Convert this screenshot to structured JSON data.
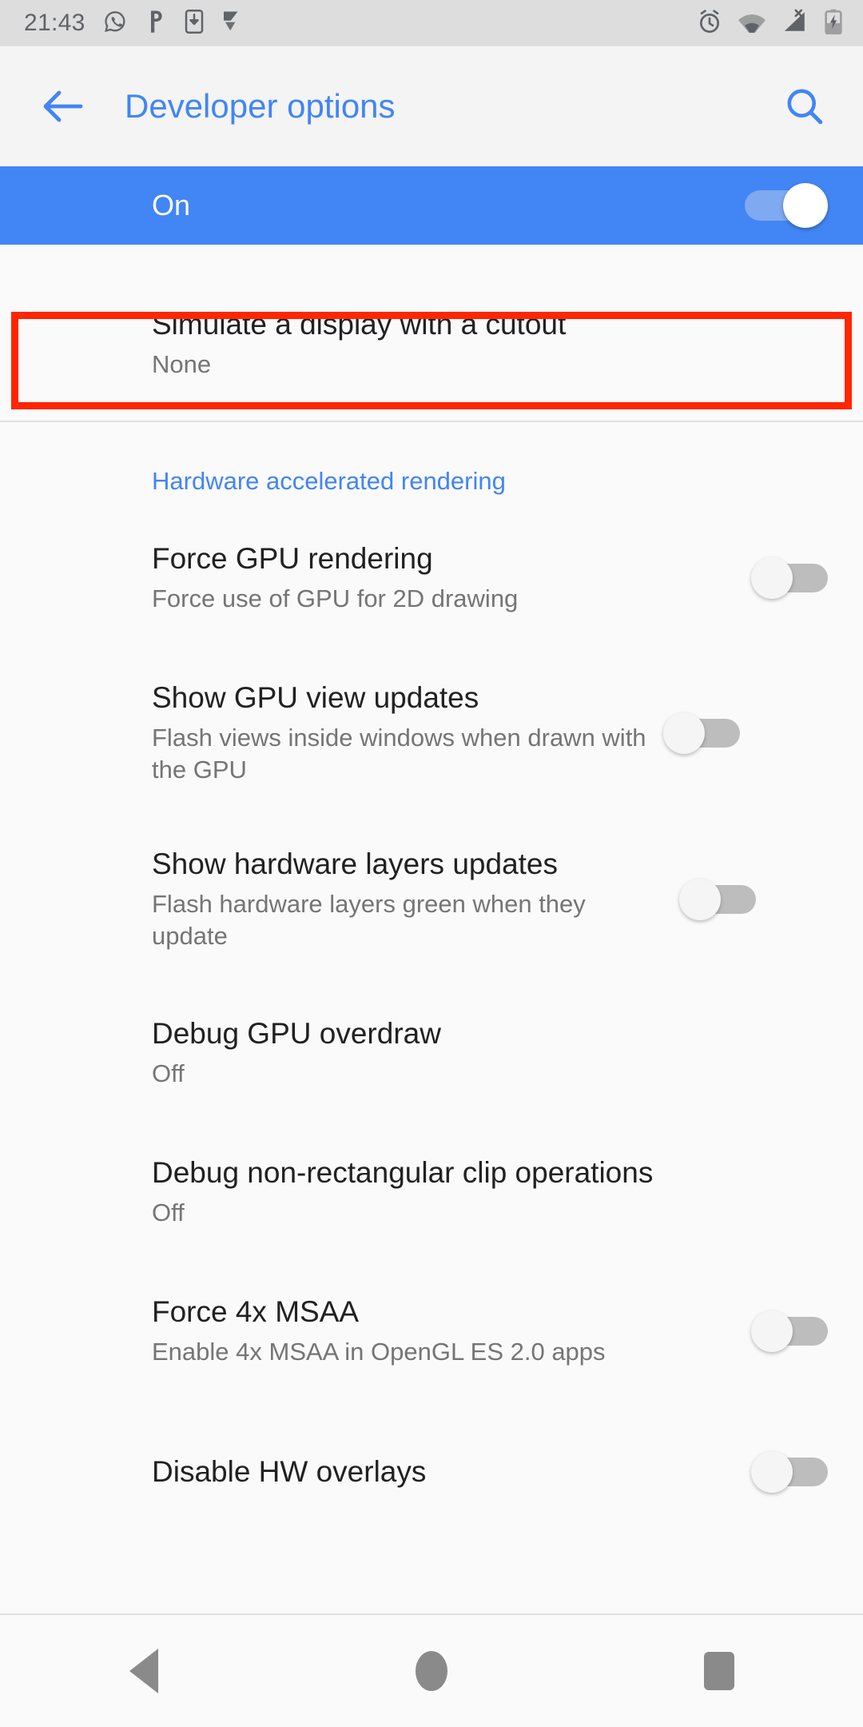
{
  "status_bar": {
    "time": "21:43",
    "left_icons": [
      "whatsapp-icon",
      "pinterest-icon",
      "download-icon",
      "flipboard-icon"
    ],
    "right_icons": [
      "alarm-icon",
      "wifi-icon",
      "cellular-no-sim-icon",
      "battery-charging-icon"
    ]
  },
  "app_bar": {
    "back_label": "back-arrow",
    "title": "Developer options",
    "search_label": "search"
  },
  "master_switch": {
    "label": "On",
    "state": "on"
  },
  "highlighted_item": {
    "title": "Simulate a display with a cutout",
    "subtitle": "None",
    "highlight_color": "#ff2600"
  },
  "section": {
    "header": "Hardware accelerated rendering"
  },
  "items": [
    {
      "title": "Force GPU rendering",
      "subtitle": "Force use of GPU for 2D drawing",
      "control": "switch",
      "state": "off"
    },
    {
      "title": "Show GPU view updates",
      "subtitle": "Flash views inside windows when drawn with the GPU",
      "control": "switch",
      "state": "off"
    },
    {
      "title": "Show hardware layers updates",
      "subtitle": "Flash hardware layers green when they update",
      "control": "switch",
      "state": "off"
    },
    {
      "title": "Debug GPU overdraw",
      "subtitle": "Off",
      "control": "none",
      "state": ""
    },
    {
      "title": "Debug non-rectangular clip operations",
      "subtitle": "Off",
      "control": "none",
      "state": ""
    },
    {
      "title": "Force 4x MSAA",
      "subtitle": "Enable 4x MSAA in OpenGL ES 2.0 apps",
      "control": "switch",
      "state": "off"
    },
    {
      "title": "Disable HW overlays",
      "subtitle": "",
      "control": "switch",
      "state": "off"
    }
  ],
  "nav_bar": {
    "back": "back-triangle",
    "home": "home-circle",
    "recents": "recents-square"
  },
  "colors": {
    "accent": "#4285f4",
    "banner": "#4285f4",
    "highlight": "#ff2600",
    "status_bg": "#dddddd",
    "page_bg": "#fafafa"
  }
}
